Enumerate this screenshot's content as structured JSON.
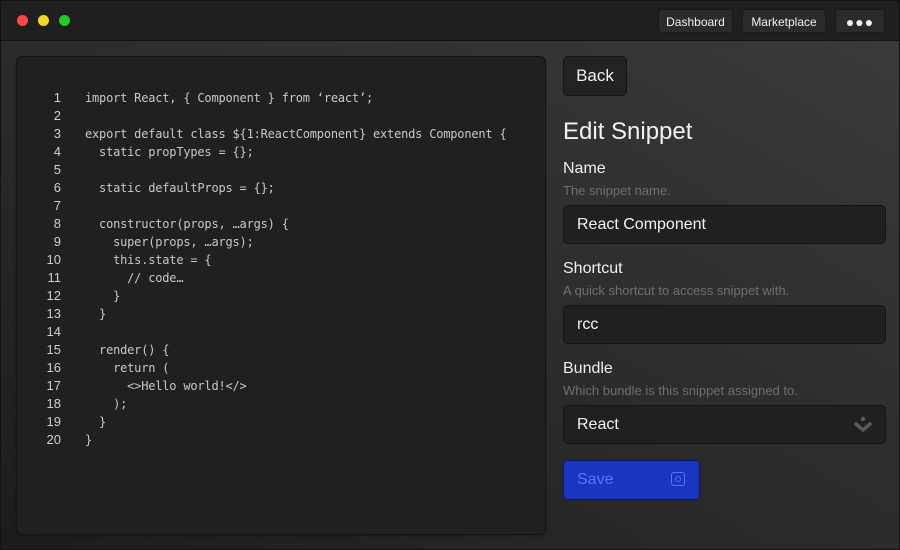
{
  "window": {
    "controls": [
      "close",
      "minimize",
      "maximize"
    ]
  },
  "nav": {
    "dashboard_label": "Dashboard",
    "marketplace_label": "Marketplace",
    "more_label": "●●●"
  },
  "editor": {
    "lines": [
      {
        "num": "1",
        "text": "import React, { Component } from ‘react’;"
      },
      {
        "num": "2",
        "text": ""
      },
      {
        "num": "3",
        "text": "export default class ${1:ReactComponent} extends Component {"
      },
      {
        "num": "4",
        "text": "  static propTypes = {};"
      },
      {
        "num": "5",
        "text": ""
      },
      {
        "num": "6",
        "text": "  static defaultProps = {};"
      },
      {
        "num": "7",
        "text": ""
      },
      {
        "num": "8",
        "text": "  constructor(props, …args) {"
      },
      {
        "num": "9",
        "text": "    super(props, …args);"
      },
      {
        "num": "10",
        "text": "    this.state = {"
      },
      {
        "num": "11",
        "text": "      // code…"
      },
      {
        "num": "12",
        "text": "    }"
      },
      {
        "num": "13",
        "text": "  }"
      },
      {
        "num": "14",
        "text": ""
      },
      {
        "num": "15",
        "text": "  render() {"
      },
      {
        "num": "16",
        "text": "    return ("
      },
      {
        "num": "17",
        "text": "      <>Hello world!</>"
      },
      {
        "num": "18",
        "text": "    );"
      },
      {
        "num": "19",
        "text": "  }"
      },
      {
        "num": "20",
        "text": "}"
      }
    ]
  },
  "form": {
    "back_label": "Back",
    "title": "Edit Snippet",
    "name": {
      "label": "Name",
      "hint": "The snippet name.",
      "value": "React Component"
    },
    "shortcut": {
      "label": "Shortcut",
      "hint": "A quick shortcut to access snippet with.",
      "value": "rcc"
    },
    "bundle": {
      "label": "Bundle",
      "hint": "Which bundle is this snippet assigned to.",
      "value": "React"
    },
    "save_label": "Save"
  },
  "colors": {
    "accent": "#1a35c0",
    "accent_text": "#4f7cf0",
    "close": "#ff4646",
    "minimize": "#f0d726",
    "maximize": "#21c925"
  }
}
